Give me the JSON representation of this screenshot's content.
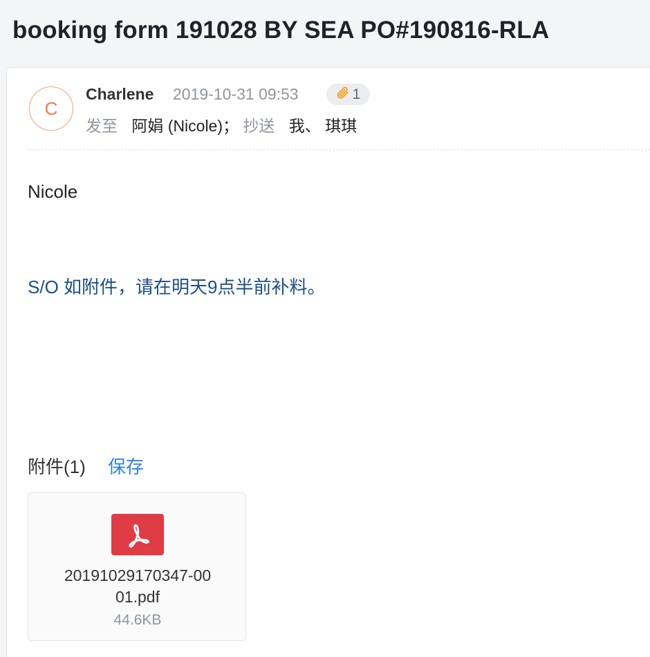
{
  "email": {
    "subject": "booking form 191028 BY SEA PO#190816-RLA",
    "sender": {
      "avatar_letter": "C",
      "name": "Charlene",
      "datetime": "2019-10-31 09:53",
      "attachment_count": "1"
    },
    "recipients": {
      "to_label": "发至",
      "to": "阿娟 (Nicole)",
      "separator": "；",
      "cc_label": "抄送",
      "cc": "我、 琪琪"
    },
    "body": {
      "greeting": "Nicole",
      "message": "S/O 如附件，请在明天9点半前补料。"
    },
    "attachments": {
      "title": "附件(1)",
      "save_label": "保存",
      "files": [
        {
          "name_line1": "20191029170347-00",
          "name_line2": "01.pdf",
          "size": "44.6KB",
          "icon": "pdf-icon"
        }
      ]
    }
  },
  "colors": {
    "avatar": "#ee7e4c",
    "link": "#2f83e6",
    "message_text": "#1c4f86",
    "pdf_red": "#e03c46"
  }
}
